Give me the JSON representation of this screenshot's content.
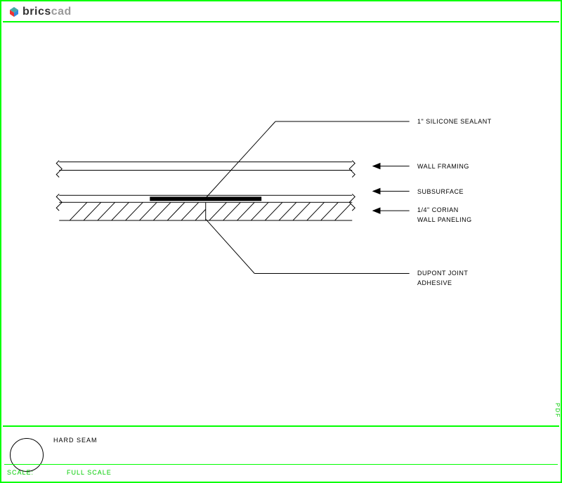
{
  "brand": {
    "part1": "brics",
    "part2": "cad"
  },
  "labels": {
    "silicone": "1\" SILICONE SEALANT",
    "wall_framing": "WALL FRAMING",
    "subsurface": "SUBSURFACE",
    "corian_line1": "1/4\" CORIAN",
    "corian_line2": "WALL PANELING",
    "adhesive_line1": "DUPONT JOINT",
    "adhesive_line2": "ADHESIVE"
  },
  "titleblock": {
    "name": "HARD SEAM",
    "scale_label": "SCALE:",
    "scale_value": "FULL SCALE"
  },
  "sidetext": "PDF"
}
